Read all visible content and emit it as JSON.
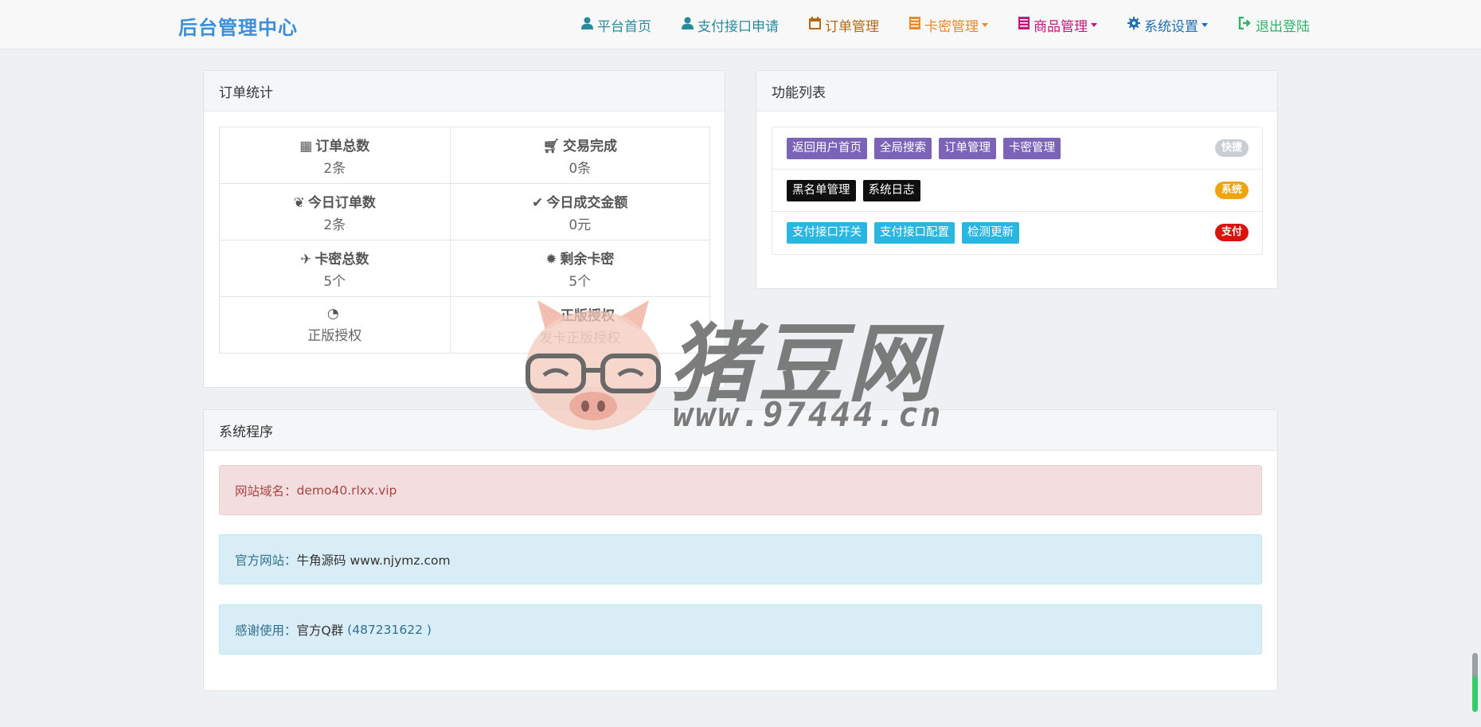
{
  "brand": "后台管理中心",
  "nav": [
    {
      "label": "平台首页",
      "icon": "user-icon",
      "color": "#2a8a9c",
      "caret": false
    },
    {
      "label": "支付接口申请",
      "icon": "user-icon",
      "color": "#2a8a9c",
      "caret": false
    },
    {
      "label": "订单管理",
      "icon": "calendar-icon",
      "color": "#b06a14",
      "caret": false
    },
    {
      "label": "卡密管理",
      "icon": "list-icon",
      "color": "#e8892a",
      "caret": true
    },
    {
      "label": "商品管理",
      "icon": "list-icon",
      "color": "#c2187a",
      "caret": true
    },
    {
      "label": "系统设置",
      "icon": "gear-icon",
      "color": "#1f6fb0",
      "caret": true
    },
    {
      "label": "退出登陆",
      "icon": "logout-icon",
      "color": "#2fb36b",
      "caret": false
    }
  ],
  "order_stats": {
    "title": "订单统计",
    "cells": [
      {
        "icon": "grid-icon",
        "label": "订单总数",
        "value": "2条"
      },
      {
        "icon": "cart-icon",
        "label": "交易完成",
        "value": "0条"
      },
      {
        "icon": "leaf-icon",
        "label": "今日订单数",
        "value": "2条"
      },
      {
        "icon": "check-icon",
        "label": "今日成交金额",
        "value": "0元"
      },
      {
        "icon": "plane-icon",
        "label": "卡密总数",
        "value": "5个"
      },
      {
        "icon": "sun-icon",
        "label": "剩余卡密",
        "value": "5个"
      },
      {
        "icon": "dashboard-icon",
        "label": "",
        "value": "正版授权"
      },
      {
        "icon": "heart-icon",
        "label": "正版授权",
        "value": "发卡正版授权"
      }
    ]
  },
  "function_list": {
    "title": "功能列表",
    "rows": [
      {
        "buttons": [
          "返回用户首页",
          "全局搜索",
          "订单管理",
          "卡密管理"
        ],
        "style": "purple",
        "badge": "快捷",
        "badge_color": "#c9ced2"
      },
      {
        "buttons": [
          "黑名单管理",
          "系统日志"
        ],
        "style": "black",
        "badge": "系统",
        "badge_color": "#f0a30a"
      },
      {
        "buttons": [
          "支付接口开关",
          "支付接口配置",
          "检测更新"
        ],
        "style": "cyan",
        "badge": "支付",
        "badge_color": "#d9140f"
      }
    ]
  },
  "system": {
    "title": "系统程序",
    "domain_label": "网站域名：",
    "domain_value": "demo40.rlxx.vip",
    "site_label": "官方网站：",
    "site_value": "牛角源码 www.njymz.com",
    "thanks_label": "感谢使用：",
    "thanks_group": "官方Q群",
    "thanks_qq": "(487231622 )"
  },
  "watermark": {
    "name": "猪豆网",
    "url": "www.97444.cn"
  }
}
